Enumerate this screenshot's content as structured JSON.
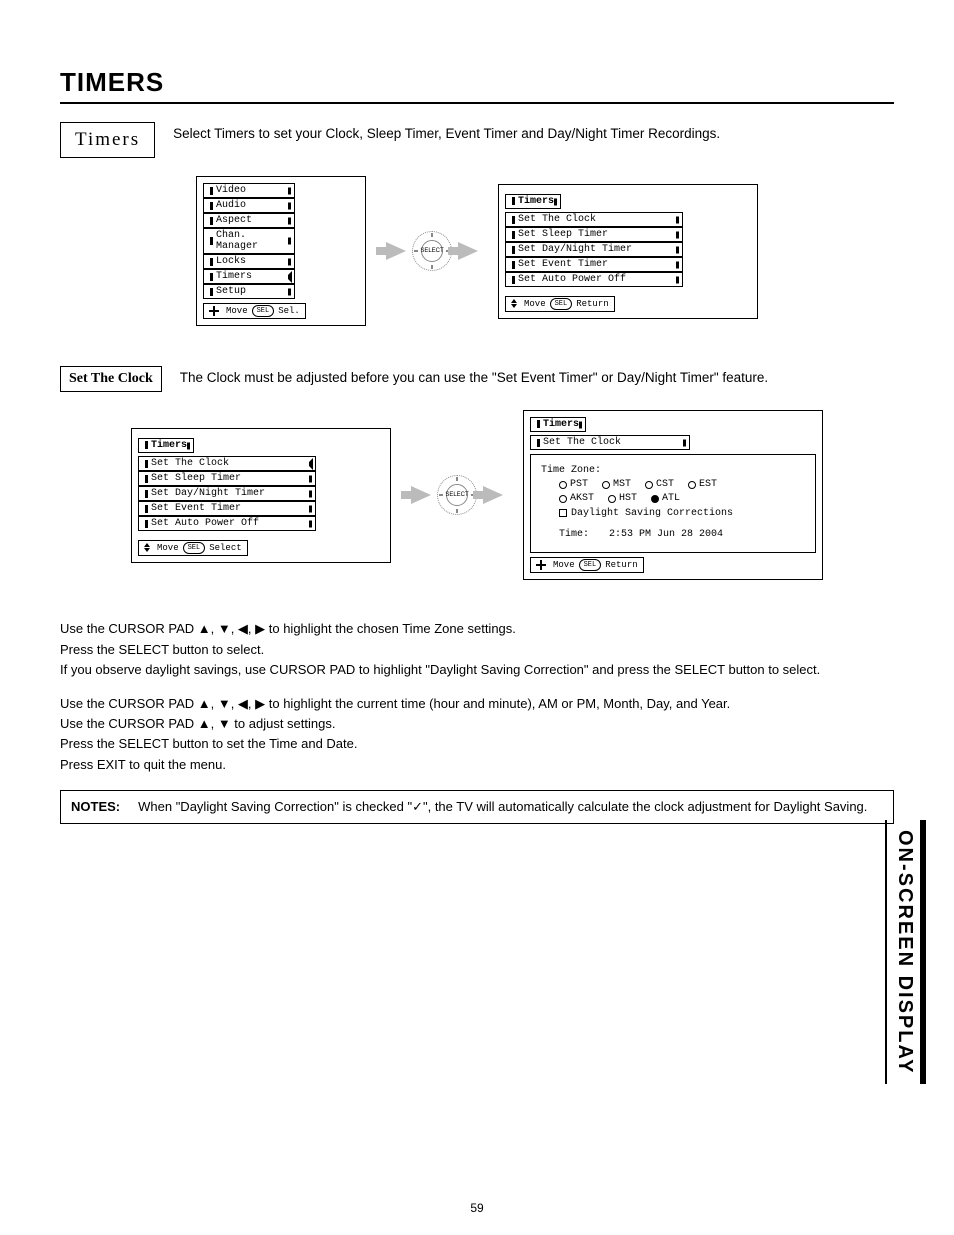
{
  "pageTitle": "TIMERS",
  "pageNumber": "59",
  "sideLabel": "ON-SCREEN DISPLAY",
  "timersSection": {
    "label": "Timers",
    "desc": "Select Timers to set your Clock, Sleep Timer, Event Timer and Day/Night Timer Recordings."
  },
  "mainMenu": {
    "items": [
      "Video",
      "Audio",
      "Aspect",
      "Chan. Manager",
      "Locks",
      "Timers",
      "Setup"
    ],
    "hint": {
      "move": "Move",
      "sel": "SEL",
      "select": "Sel."
    }
  },
  "timersMenu": {
    "tab": "Timers",
    "items": [
      "Set The Clock",
      "Set Sleep Timer",
      "Set Day/Night Timer",
      "Set Event Timer",
      "Set Auto Power Off"
    ],
    "hint": {
      "move": "Move",
      "sel": "SEL",
      "ret": "Return"
    }
  },
  "selectDial": "SELECT",
  "setClockSection": {
    "label": "Set The Clock",
    "desc": "The Clock must be adjusted before you can use the \"Set Event Timer\" or Day/Night Timer\" feature."
  },
  "timersMenu2": {
    "tab": "Timers",
    "items": [
      "Set The Clock",
      "Set Sleep Timer",
      "Set Day/Night Timer",
      "Set Event Timer",
      "Set Auto Power Off"
    ],
    "highlight": 0,
    "hint": {
      "move": "Move",
      "sel": "SEL",
      "ret": "Select"
    }
  },
  "clockPanel": {
    "tab": "Timers",
    "subtab": "Set The Clock",
    "tzLabel": "Time Zone:",
    "tzRow1": [
      "PST",
      "MST",
      "CST",
      "EST"
    ],
    "tzRow2": [
      "AKST",
      "HST",
      "ATL"
    ],
    "tzSelected": "ATL",
    "dst": "Daylight Saving Corrections",
    "timeLabel": "Time:",
    "timeValue": "2:53 PM Jun 28 2004",
    "hint": {
      "move": "Move",
      "sel": "SEL",
      "ret": "Return"
    }
  },
  "instructions1": [
    "Use the CURSOR PAD ▲, ▼, ◀, ▶ to highlight the chosen Time Zone settings.",
    "Press the SELECT button to select.",
    "If you observe daylight savings, use CURSOR PAD to highlight \"Daylight Saving Correction\" and press the SELECT button to select."
  ],
  "instructions2": [
    "Use the CURSOR PAD ▲, ▼, ◀, ▶ to highlight the current time (hour and minute), AM or PM, Month, Day, and Year.",
    "Use the CURSOR PAD ▲, ▼ to adjust settings.",
    "Press the SELECT button to set the Time and Date.",
    "Press EXIT to quit the menu."
  ],
  "notes": {
    "label": "NOTES:",
    "text": "When \"Daylight Saving Correction\" is checked \"✓\", the TV will automatically calculate the clock adjustment for Daylight Saving."
  }
}
